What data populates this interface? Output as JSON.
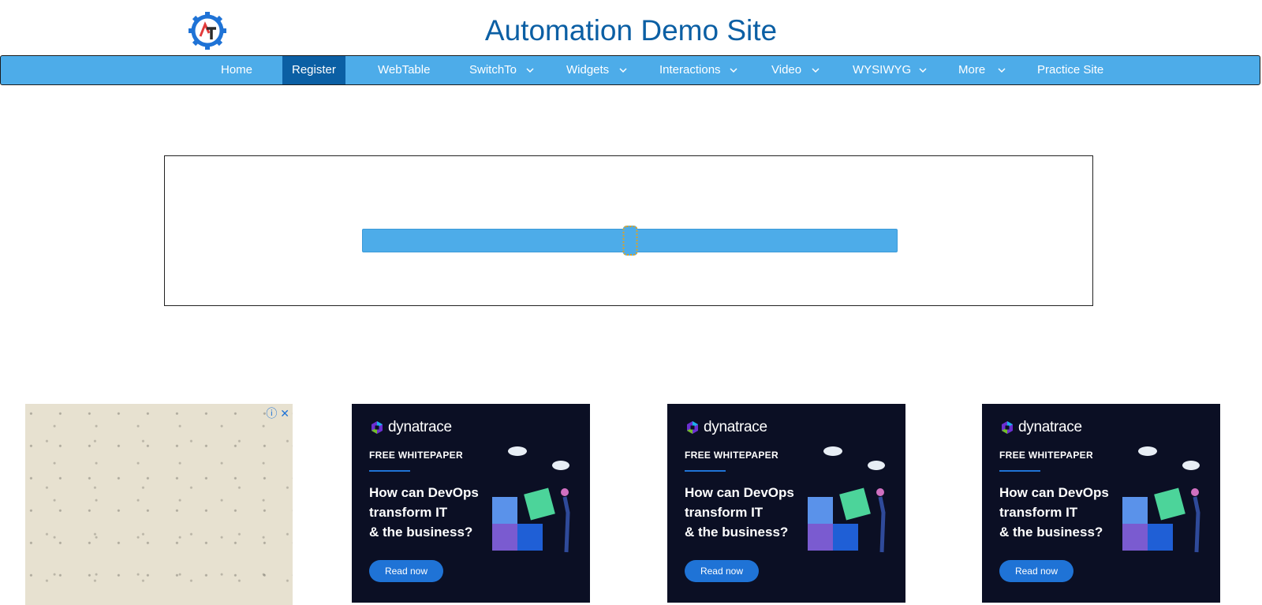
{
  "header": {
    "title": "Automation Demo Site",
    "logo_icon": "gear-logo-icon"
  },
  "nav": {
    "items": [
      {
        "label": "Home",
        "dropdown": false
      },
      {
        "label": "Register",
        "dropdown": false,
        "active": true
      },
      {
        "label": "WebTable",
        "dropdown": false
      },
      {
        "label": "SwitchTo",
        "dropdown": true
      },
      {
        "label": "Widgets",
        "dropdown": true
      },
      {
        "label": "Interactions",
        "dropdown": true
      },
      {
        "label": "Video",
        "dropdown": true
      },
      {
        "label": "WYSIWYG",
        "dropdown": true
      },
      {
        "label": "More",
        "dropdown": true
      },
      {
        "label": "Practice Site",
        "dropdown": false
      }
    ]
  },
  "slider": {
    "value_fraction": 0.5
  },
  "ads": [
    {
      "brand": "dynatrace",
      "eyebrow": "FREE WHITEPAPER",
      "headline": [
        "How can DevOps",
        "transform IT",
        "& the business?"
      ],
      "cta": "Read now"
    },
    {
      "brand": "dynatrace",
      "eyebrow": "FREE WHITEPAPER",
      "headline": [
        "How can DevOps",
        "transform IT",
        "& the business?"
      ],
      "cta": "Read now"
    },
    {
      "brand": "dynatrace",
      "eyebrow": "FREE WHITEPAPER",
      "headline": [
        "How can DevOps",
        "transform IT",
        "& the business?"
      ],
      "cta": "Read now"
    }
  ],
  "colors": {
    "title": "#0b5fa4",
    "nav_bg": "#4dace9",
    "nav_active": "#0b5fa4",
    "ad_bg": "#0b0f24",
    "ad_cta": "#1f73d6"
  }
}
